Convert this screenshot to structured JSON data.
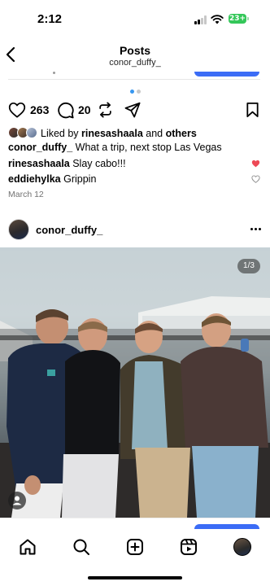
{
  "status_bar": {
    "time": "2:12",
    "battery": "23+"
  },
  "header": {
    "title": "Posts",
    "subtitle": "conor_duffy_",
    "back_icon": "chevron-left-icon"
  },
  "post1": {
    "carousel_dot_count": 2,
    "carousel_active_index": 0,
    "like_count": "263",
    "comment_count": "20",
    "liked_by_prefix": "Liked by ",
    "liked_by_user": "rinesashaala",
    "liked_by_and": " and ",
    "liked_by_others": "others",
    "caption_user": "conor_duffy_",
    "caption_text": " What a trip, next stop Las Vegas",
    "comments": [
      {
        "user": "rinesashaala",
        "text": " Slay cabo!!!",
        "liked": true
      },
      {
        "user": "eddiehylka",
        "text": " Grippin",
        "liked": false
      }
    ],
    "date": "March 12"
  },
  "post2": {
    "username": "conor_duffy_",
    "photo_counter": "1/3"
  },
  "tab_bar": {
    "items": [
      "home-icon",
      "search-icon",
      "create-icon",
      "reels-icon",
      "profile-avatar"
    ]
  },
  "colors": {
    "accent_blue": "#3b6cf6",
    "like_red": "#ed4956",
    "battery_green": "#34c759"
  }
}
